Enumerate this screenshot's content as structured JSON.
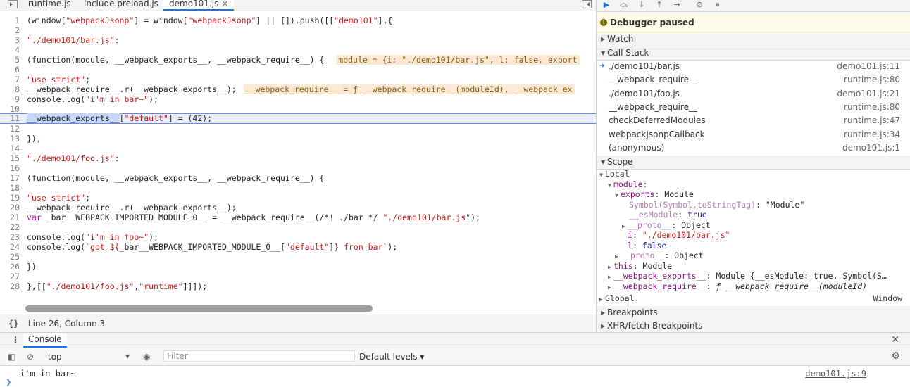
{
  "editor": {
    "tabs": [
      {
        "label": "runtime.js",
        "active": false
      },
      {
        "label": "include.preload.js",
        "active": false
      },
      {
        "label": "demo101.js",
        "active": true,
        "close": "×"
      }
    ],
    "code_lines": [
      {
        "n": "1",
        "parts": [
          [
            "t",
            "(window["
          ],
          [
            "s",
            "\"webpackJsonp\""
          ],
          [
            "t",
            "] = window["
          ],
          [
            "s",
            "\"webpackJsonp\""
          ],
          [
            "t",
            "] || []).push([["
          ],
          [
            "s",
            "\"demo101\""
          ],
          [
            "t",
            "],{"
          ]
        ]
      },
      {
        "n": "2",
        "parts": []
      },
      {
        "n": "3",
        "parts": [
          [
            "s",
            "\"./demo101/bar.js\""
          ],
          [
            "t",
            ":"
          ]
        ]
      },
      {
        "n": "4",
        "parts": []
      },
      {
        "n": "5",
        "parts": [
          [
            "t",
            "(function(module, __webpack_exports__, __webpack_require__) { "
          ]
        ],
        "inline": "module = {i: \"./demo101/bar.js\", l: false, export"
      },
      {
        "n": "6",
        "parts": []
      },
      {
        "n": "7",
        "parts": [
          [
            "s",
            "\"use strict\""
          ],
          [
            "t",
            ";"
          ]
        ]
      },
      {
        "n": "8",
        "parts": [
          [
            "t",
            "__webpack_require__.r(__webpack_exports__);"
          ]
        ],
        "inline": "__webpack_require__ = ƒ __webpack_require__(moduleId), __webpack_ex"
      },
      {
        "n": "9",
        "parts": [
          [
            "t",
            "console.log("
          ],
          [
            "s",
            "\"i'm in bar~\""
          ],
          [
            "t",
            ");"
          ]
        ]
      },
      {
        "n": "10",
        "parts": []
      },
      {
        "n": "11",
        "parts": [
          [
            "h",
            "__webpack_exports__"
          ],
          [
            "t",
            "["
          ],
          [
            "s",
            "\"default\""
          ],
          [
            "t",
            "] = (42);"
          ]
        ],
        "highlight": true
      },
      {
        "n": "12",
        "parts": []
      },
      {
        "n": "13",
        "parts": [
          [
            "t",
            "}),"
          ]
        ]
      },
      {
        "n": "14",
        "parts": []
      },
      {
        "n": "15",
        "parts": [
          [
            "s",
            "\"./demo101/foo.js\""
          ],
          [
            "t",
            ":"
          ]
        ]
      },
      {
        "n": "16",
        "parts": []
      },
      {
        "n": "17",
        "parts": [
          [
            "t",
            "(function(module, __webpack_exports__, __webpack_require__) {"
          ]
        ]
      },
      {
        "n": "18",
        "parts": []
      },
      {
        "n": "19",
        "parts": [
          [
            "s",
            "\"use strict\""
          ],
          [
            "t",
            ";"
          ]
        ]
      },
      {
        "n": "20",
        "parts": [
          [
            "t",
            "__webpack_require__.r(__webpack_exports__);"
          ]
        ]
      },
      {
        "n": "21",
        "parts": [
          [
            "k",
            "var"
          ],
          [
            "t",
            " _bar__WEBPACK_IMPORTED_MODULE_0__ = __webpack_require__(/*! ./bar */ "
          ],
          [
            "s",
            "\"./demo101/bar.js\""
          ],
          [
            "t",
            ");"
          ]
        ]
      },
      {
        "n": "22",
        "parts": []
      },
      {
        "n": "23",
        "parts": [
          [
            "t",
            "console.log("
          ],
          [
            "s",
            "\"i'm in foo~\""
          ],
          [
            "t",
            ");"
          ]
        ]
      },
      {
        "n": "24",
        "parts": [
          [
            "t",
            "console.log("
          ],
          [
            "s",
            "`got ${"
          ],
          [
            "t",
            "_bar__WEBPACK_IMPORTED_MODULE_0__["
          ],
          [
            "s",
            "\"default\""
          ],
          [
            "t",
            "]"
          ],
          [
            "s",
            "} fron bar`"
          ],
          [
            "t",
            ");"
          ]
        ]
      },
      {
        "n": "25",
        "parts": []
      },
      {
        "n": "26",
        "parts": [
          [
            "t",
            "})"
          ]
        ]
      },
      {
        "n": "27",
        "parts": []
      },
      {
        "n": "28",
        "parts": [
          [
            "t",
            "},[["
          ],
          [
            "s",
            "\"./demo101/foo.js\""
          ],
          [
            "t",
            ","
          ],
          [
            "s",
            "\"runtime\""
          ],
          [
            "t",
            "]]]);"
          ]
        ]
      }
    ],
    "status": {
      "brace": "{}",
      "position": "Line 26, Column 3"
    }
  },
  "debugger": {
    "paused_label": "Debugger paused",
    "paused_icon": "!",
    "sections": {
      "watch": "Watch",
      "call_stack": "Call Stack",
      "scope": "Scope",
      "breakpoints": "Breakpoints",
      "xhr": "XHR/fetch Breakpoints"
    },
    "call_stack": [
      {
        "name": "./demo101/bar.js",
        "loc": "demo101.js:11",
        "current": true
      },
      {
        "name": "__webpack_require__",
        "loc": "runtime.js:80"
      },
      {
        "name": "./demo101/foo.js",
        "loc": "demo101.js:21"
      },
      {
        "name": "__webpack_require__",
        "loc": "runtime.js:80"
      },
      {
        "name": "checkDeferredModules",
        "loc": "runtime.js:47"
      },
      {
        "name": "webpackJsonpCallback",
        "loc": "runtime.js:34"
      },
      {
        "name": "(anonymous)",
        "loc": "demo101.js:1"
      }
    ],
    "scope": {
      "local": "Local",
      "module": "module:",
      "exports_key": "exports",
      "exports_val": "Module",
      "symbol_key": "Symbol(Symbol.toStringTag)",
      "symbol_val": "\"Module\"",
      "esmodule_key": "__esModule",
      "esmodule_val": "true",
      "proto_key": "__proto__",
      "proto_val": "Object",
      "i_key": "i",
      "i_val": "\"./demo101/bar.js\"",
      "l_key": "l",
      "l_val": "false",
      "proto2_key": "__proto__",
      "proto2_val": "Object",
      "this_key": "this",
      "this_val": "Module",
      "wexports_key": "__webpack_exports__",
      "wexports_val": "Module {__esModule: true, Symbol(S…",
      "wrequire_key": "__webpack_require__",
      "wrequire_val": "ƒ __webpack_require__(moduleId)",
      "global": "Global",
      "global_val": "Window"
    }
  },
  "console": {
    "tab_label": "Console",
    "context": "top",
    "filter_placeholder": "Filter",
    "levels": "Default levels ▾",
    "message": "i'm in bar~",
    "message_source": "demo101.js:9",
    "prompt": "❯"
  }
}
